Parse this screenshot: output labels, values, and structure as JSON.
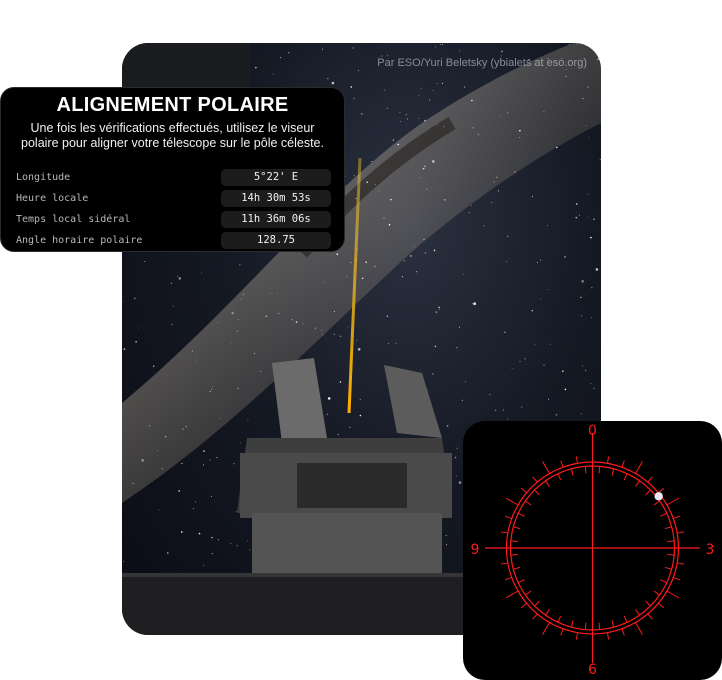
{
  "photo": {
    "credit": "Par ESO/Yuri Beletsky (ybialets at eso.org)"
  },
  "panel": {
    "title": "ALIGNEMENT POLAIRE",
    "description": "Une fois les vérifications effectués, utilisez le viseur polaire pour aligner votre télescope sur le pôle céleste.",
    "rows": [
      {
        "label": "Longitude",
        "value": "5°22' E"
      },
      {
        "label": "Heure locale",
        "value": "14h 30m 53s"
      },
      {
        "label": "Temps local sidéral",
        "value": "11h 36m 06s"
      },
      {
        "label": "Angle horaire polaire",
        "value": "128.75"
      }
    ]
  },
  "scope": {
    "labels": {
      "top": "0",
      "right": "3",
      "bottom": "6",
      "left": "9"
    },
    "hour_angle_deg": 128.75,
    "color": "#ff1a1a"
  }
}
